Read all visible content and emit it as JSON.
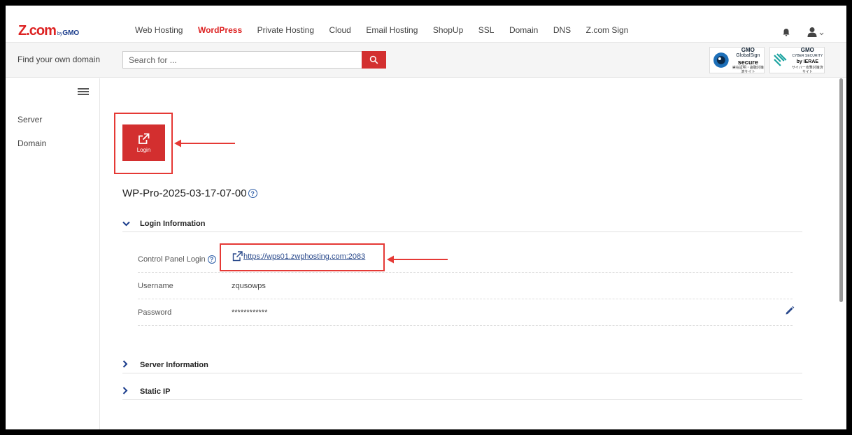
{
  "brand": {
    "logo_main": "Z.com",
    "logo_by": "by",
    "logo_gmo": "GMO"
  },
  "nav": {
    "items": [
      {
        "label": "Web Hosting",
        "active": false
      },
      {
        "label": "WordPress",
        "active": true
      },
      {
        "label": "Private Hosting",
        "active": false
      },
      {
        "label": "Cloud",
        "active": false
      },
      {
        "label": "Email Hosting",
        "active": false
      },
      {
        "label": "ShopUp",
        "active": false
      },
      {
        "label": "SSL",
        "active": false
      },
      {
        "label": "Domain",
        "active": false
      },
      {
        "label": "DNS",
        "active": false
      },
      {
        "label": "Z.com Sign",
        "active": false
      }
    ],
    "icons": [
      "bell-icon",
      "user-icon",
      "chevron-down-icon"
    ]
  },
  "search": {
    "label": "Find your own domain",
    "placeholder": "Search for ...",
    "button_icon": "search-icon"
  },
  "badges": {
    "b1": {
      "line1": "GMO",
      "line2": "GlobalSign",
      "line3": "secure",
      "line4": "実在証明・盗聴対策済サイト"
    },
    "b2": {
      "line1": "GMO",
      "line2": "CYBER SECURITY",
      "line3": "by IERAE",
      "line4": "サイバー攻撃対策済サイト"
    }
  },
  "sidebar": {
    "items": [
      {
        "label": "Server"
      },
      {
        "label": "Domain"
      }
    ]
  },
  "main": {
    "login_button": {
      "label": "Login",
      "icon": "external-link-icon"
    },
    "title": "WP-Pro-2025-03-17-07-00",
    "help_glyph": "?",
    "login_info": {
      "heading": "Login Information",
      "rows": {
        "control_panel": {
          "key": "Control Panel Login",
          "value": "https://wps01.zwphosting.com:2083"
        },
        "username": {
          "key": "Username",
          "value": "zqusowps"
        },
        "password": {
          "key": "Password",
          "value": "************"
        }
      }
    },
    "server_info": {
      "heading": "Server Information"
    },
    "static_ip": {
      "heading": "Static IP"
    }
  },
  "colors": {
    "accent": "#d32f2f",
    "link": "#2b4a8c",
    "highlight": "#e53935",
    "nav_active": "#dd2222"
  }
}
